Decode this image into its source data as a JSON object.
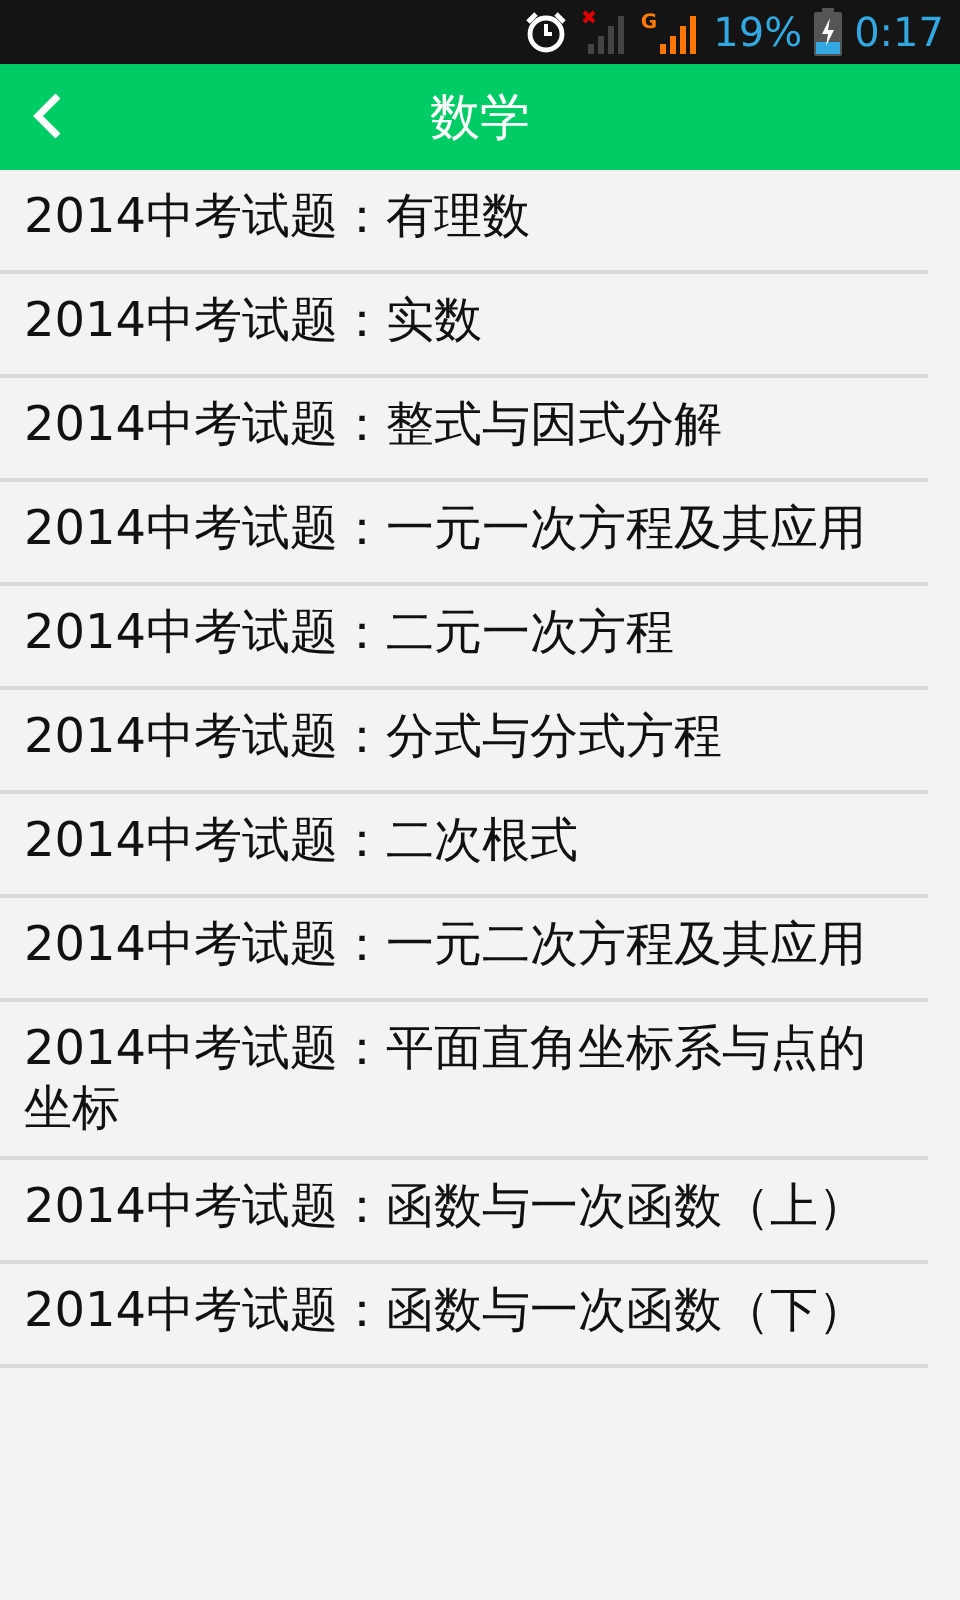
{
  "status_bar": {
    "network": "G",
    "battery": "19%",
    "time": "0:17"
  },
  "header": {
    "title": "数学"
  },
  "items": [
    {
      "text": "2014中考试题：有理数"
    },
    {
      "text": "2014中考试题：实数"
    },
    {
      "text": "2014中考试题：整式与因式分解"
    },
    {
      "text": "2014中考试题：一元一次方程及其应用"
    },
    {
      "text": "2014中考试题：二元一次方程"
    },
    {
      "text": "2014中考试题：分式与分式方程"
    },
    {
      "text": "2014中考试题：二次根式"
    },
    {
      "text": "2014中考试题：一元二次方程及其应用"
    },
    {
      "text": "2014中考试题：平面直角坐标系与点的坐标"
    },
    {
      "text": "2014中考试题：函数与一次函数（上）"
    },
    {
      "text": "2014中考试题：函数与一次函数（下）"
    }
  ]
}
